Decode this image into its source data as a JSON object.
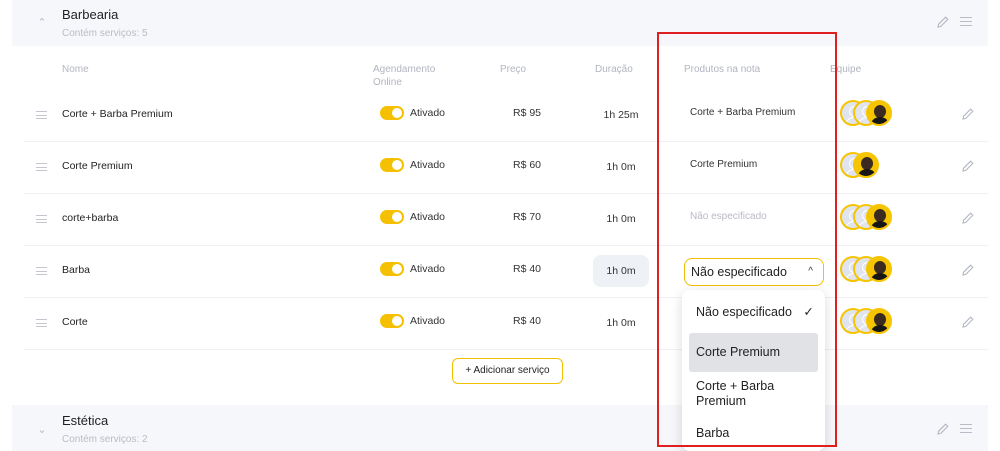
{
  "groups": [
    {
      "title": "Barbearia",
      "subtitle": "Contém serviços: 5",
      "expanded": true
    },
    {
      "title": "Estética",
      "subtitle": "Contém serviços: 2",
      "expanded": false
    }
  ],
  "columns": {
    "name": "Nome",
    "online_line1": "Agendamento",
    "online_line2": "Online",
    "price": "Preço",
    "duration": "Duração",
    "products": "Produtos na nota",
    "team": "Equipe"
  },
  "services": [
    {
      "name": "Corte + Barba Premium",
      "status": "Ativado",
      "price": "R$ 95",
      "duration": "1h 25m",
      "product": "Corte + Barba Premium",
      "product_muted": false
    },
    {
      "name": "Corte Premium",
      "status": "Ativado",
      "price": "R$ 60",
      "duration": "1h 0m",
      "product": "Corte Premium",
      "product_muted": false
    },
    {
      "name": "corte+barba",
      "status": "Ativado",
      "price": "R$ 70",
      "duration": "1h 0m",
      "product": "Não especificado",
      "product_muted": true
    },
    {
      "name": "Barba",
      "status": "Ativado",
      "price": "R$ 40",
      "duration": "1h 0m",
      "product": "",
      "product_muted": false
    },
    {
      "name": "Corte",
      "status": "Ativado",
      "price": "R$ 40",
      "duration": "1h 0m",
      "product": "",
      "product_muted": false
    }
  ],
  "add_service_label": "+ Adicionar serviço",
  "product_select": {
    "value": "Não especificado",
    "caret": "^",
    "options": [
      {
        "label": "Não especificado",
        "check": "✓"
      },
      {
        "label": "Corte Premium",
        "check": ""
      },
      {
        "label": "Corte + Barba Premium",
        "check": ""
      },
      {
        "label": "Barba",
        "check": ""
      }
    ]
  },
  "colors": {
    "accent": "#f5c000",
    "highlight_box": "#e02020"
  },
  "icons": {
    "edit": "pencil-icon",
    "reorder": "drag-handle-icon",
    "collapse": "chevron-icon"
  }
}
